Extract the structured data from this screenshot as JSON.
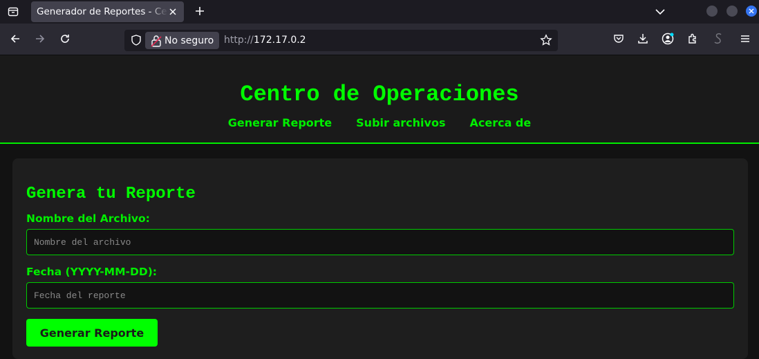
{
  "browser": {
    "tab_title": "Generador de Reportes - Centro de Operaciones",
    "security_label": "No seguro",
    "url_scheme": "http://",
    "url_host": "172.17.0.2"
  },
  "header": {
    "title": "Centro de Operaciones",
    "nav": [
      "Generar Reporte",
      "Subir archivos",
      "Acerca de"
    ]
  },
  "form": {
    "title": "Genera tu Reporte",
    "filename_label": "Nombre del Archivo:",
    "filename_placeholder": "Nombre del archivo",
    "date_label": "Fecha (YYYY-MM-DD):",
    "date_placeholder": "Fecha del reporte",
    "submit_label": "Generar Reporte"
  },
  "colors": {
    "accent": "#00ff00",
    "background": "#121212",
    "card": "#1e1e1e"
  }
}
